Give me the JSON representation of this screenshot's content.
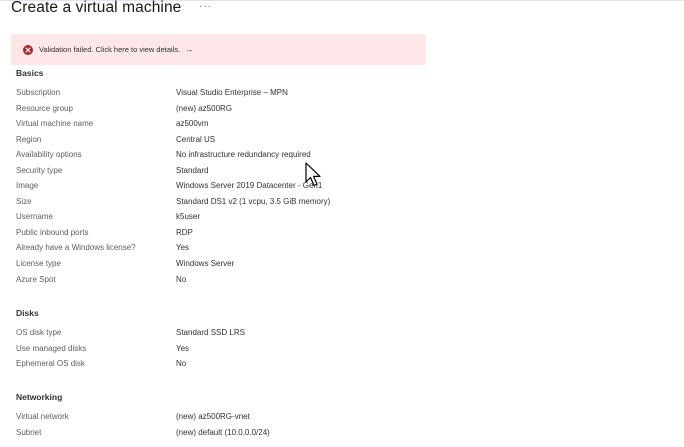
{
  "page": {
    "title": "Create a virtual machine",
    "more_label": "···"
  },
  "banner": {
    "icon": "error-circle-icon",
    "text": "Validation failed. Click here to view details.",
    "arrow": "→",
    "color": "#fde7e9"
  },
  "basics": {
    "heading": "Basics",
    "rows": [
      {
        "label": "Subscription",
        "value": "Visual Studio Enterprise – MPN"
      },
      {
        "label": "Resource group",
        "value": "(new) az500RG"
      },
      {
        "label": "Virtual machine name",
        "value": "az500vm"
      },
      {
        "label": "Region",
        "value": "Central US"
      },
      {
        "label": "Availability options",
        "value": "No infrastructure redundancy required"
      },
      {
        "label": "Security type",
        "value": "Standard"
      },
      {
        "label": "Image",
        "value": "Windows Server 2019 Datacenter - Gen1"
      },
      {
        "label": "Size",
        "value": "Standard DS1 v2 (1 vcpu, 3.5 GiB memory)"
      },
      {
        "label": "Username",
        "value": "k5user"
      },
      {
        "label": "Public inbound ports",
        "value": "RDP"
      },
      {
        "label": "Already have a Windows license?",
        "value": "Yes"
      },
      {
        "label": "License type",
        "value": "Windows Server"
      },
      {
        "label": "Azure Spot",
        "value": "No"
      }
    ]
  },
  "disks": {
    "heading": "Disks",
    "rows": [
      {
        "label": "OS disk type",
        "value": "Standard SSD LRS"
      },
      {
        "label": "Use managed disks",
        "value": "Yes"
      },
      {
        "label": "Ephemeral OS disk",
        "value": "No"
      }
    ]
  },
  "networking": {
    "heading": "Networking",
    "rows": [
      {
        "label": "Virtual network",
        "value": "(new) az500RG-vnet"
      },
      {
        "label": "Subnet",
        "value": "(new) default (10.0.0.0/24)"
      }
    ]
  }
}
